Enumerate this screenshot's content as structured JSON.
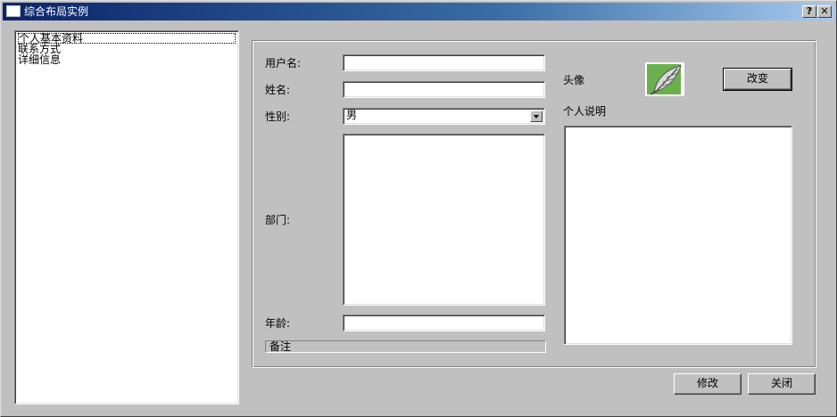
{
  "window": {
    "title": "综合布局实例",
    "help_glyph": "?",
    "close_glyph": "✕"
  },
  "nav": {
    "items": [
      {
        "label": "个人基本资料",
        "selected": true
      },
      {
        "label": "联系方式",
        "selected": false
      },
      {
        "label": "详细信息",
        "selected": false
      }
    ]
  },
  "form": {
    "username_label": "用户名:",
    "username_value": "",
    "name_label": "姓名:",
    "name_value": "",
    "gender_label": "性别:",
    "gender_value": "男",
    "department_label": "部门:",
    "department_value": "",
    "age_label": "年龄:",
    "age_value": "",
    "remark_label": "备注",
    "avatar_label": "头像",
    "avatar_icon": "feather-icon",
    "change_button": "改变",
    "bio_label": "个人说明",
    "bio_value": ""
  },
  "footer": {
    "modify_button": "修改",
    "close_button": "关闭"
  },
  "colors": {
    "face": "#c0c0c0",
    "title_gradient_start": "#0a246a",
    "title_gradient_end": "#a6caf0",
    "avatar_green": "#6ab04c"
  }
}
